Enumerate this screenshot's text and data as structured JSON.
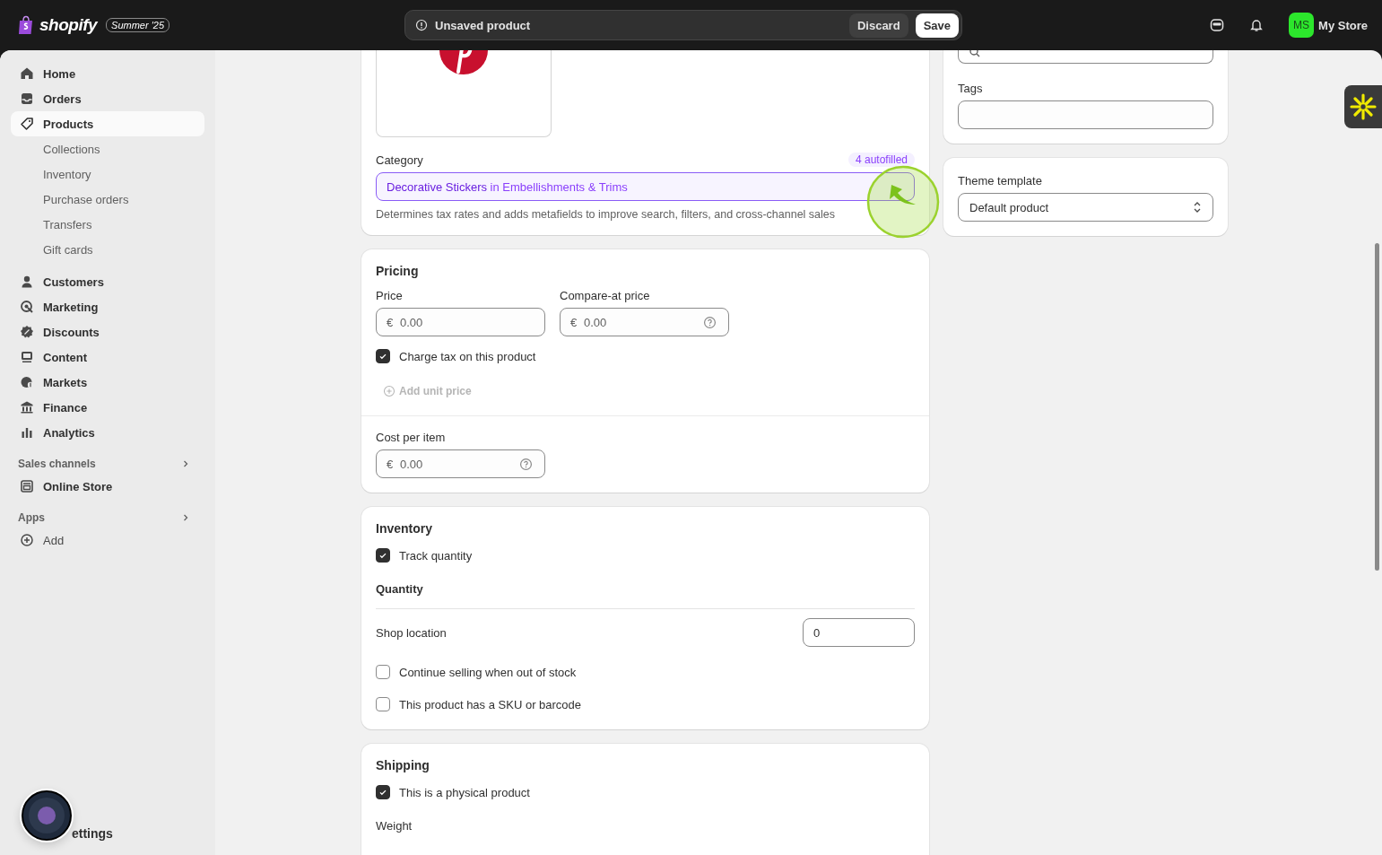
{
  "topbar": {
    "logo": "shopify",
    "edition": "Summer '25",
    "status": "Unsaved product",
    "discard": "Discard",
    "save": "Save",
    "avatar": "MS",
    "store": "My Store"
  },
  "sidebar": {
    "items": [
      {
        "label": "Home",
        "kind": "main",
        "selected": false
      },
      {
        "label": "Orders",
        "kind": "main",
        "selected": false
      },
      {
        "label": "Products",
        "kind": "main",
        "selected": true
      },
      {
        "label": "Collections",
        "kind": "sub",
        "selected": false
      },
      {
        "label": "Inventory",
        "kind": "sub",
        "selected": false
      },
      {
        "label": "Purchase orders",
        "kind": "sub",
        "selected": false
      },
      {
        "label": "Transfers",
        "kind": "sub",
        "selected": false
      },
      {
        "label": "Gift cards",
        "kind": "sub",
        "selected": false
      }
    ],
    "more_items": [
      {
        "label": "Customers",
        "selected": false
      },
      {
        "label": "Marketing",
        "selected": false
      },
      {
        "label": "Discounts",
        "selected": false
      },
      {
        "label": "Content",
        "selected": false
      },
      {
        "label": "Markets",
        "selected": false
      },
      {
        "label": "Finance",
        "selected": false
      },
      {
        "label": "Analytics",
        "selected": false
      }
    ],
    "sales_channels": {
      "heading": "Sales channels",
      "items": [
        {
          "label": "Online Store",
          "selected": false
        }
      ]
    },
    "apps": {
      "heading": "Apps",
      "items": [
        {
          "label": "Add",
          "selected": false
        }
      ]
    },
    "settings": "ettings"
  },
  "category": {
    "label": "Category",
    "badge": "4 autofilled",
    "value_name": "Decorative Stickers",
    "value_path": "in Embellishments & Trims",
    "help": "Determines tax rates and adds metafields to improve search, filters, and cross-channel sales"
  },
  "pricing": {
    "title": "Pricing",
    "fields": [
      {
        "label": "Price",
        "prefix": "€",
        "placeholder": "0.00",
        "help_icon": false
      },
      {
        "label": "Compare-at price",
        "prefix": "€",
        "placeholder": "0.00",
        "help_icon": true
      }
    ],
    "charge_tax": {
      "label": "Charge tax on this product",
      "checked": true
    },
    "unit_price": {
      "label": "Add unit price",
      "disabled": true
    },
    "cost": {
      "label": "Cost per item",
      "prefix": "€",
      "placeholder": "0.00",
      "help_icon": true
    }
  },
  "inventory": {
    "title": "Inventory",
    "track": {
      "label": "Track quantity",
      "checked": true
    },
    "quantity_title": "Quantity",
    "location": "Shop location",
    "quantity": "0",
    "options": [
      {
        "label": "Continue selling when out of stock",
        "checked": false
      },
      {
        "label": "This product has a SKU or barcode",
        "checked": false
      }
    ]
  },
  "shipping": {
    "title": "Shipping",
    "physical": {
      "label": "This is a physical product",
      "checked": true
    },
    "weight": "Weight"
  },
  "organization": {
    "tags": "Tags"
  },
  "theme": {
    "label": "Theme template",
    "value": "Default product"
  }
}
